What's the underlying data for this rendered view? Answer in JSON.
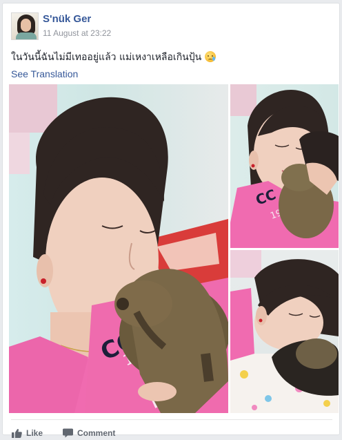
{
  "post": {
    "author_name": "S'nük Ger",
    "timestamp": "11 August at 23:22",
    "text": "ในวันนี้ฉันไม่มีเทออยู่แล้ว แม่เหงาเหลือเกินปุ้น",
    "see_translation_label": "See Translation",
    "emoji_icon": "crying-face-icon"
  },
  "photos": [
    {
      "name": "photo-woman-with-pet-main"
    },
    {
      "name": "photo-woman-hugging-pet"
    },
    {
      "name": "photo-woman-lying-with-pet"
    }
  ],
  "actions": {
    "like_label": "Like",
    "comment_label": "Comment"
  },
  "colors": {
    "link_blue": "#365899",
    "meta_gray": "#90949c",
    "action_gray": "#616770",
    "shirt_pink": "#f06bb0"
  }
}
